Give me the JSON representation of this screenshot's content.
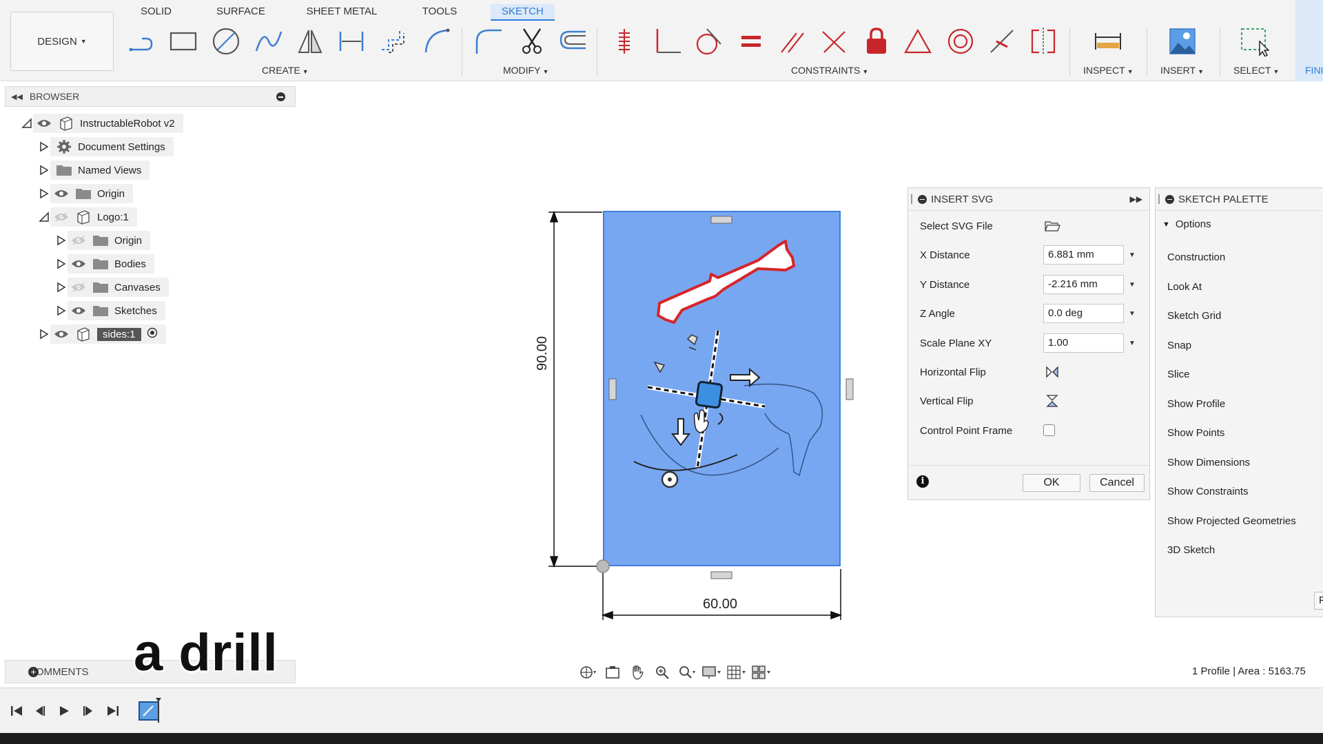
{
  "toolbar": {
    "workspace_label": "DESIGN",
    "tabs": [
      "SOLID",
      "SURFACE",
      "SHEET METAL",
      "TOOLS",
      "SKETCH"
    ],
    "active_tab": "SKETCH",
    "groups": {
      "create": "CREATE",
      "modify": "MODIFY",
      "constraints": "CONSTRAINTS",
      "inspect": "INSPECT",
      "insert": "INSERT",
      "select": "SELECT",
      "finish": "FINI"
    },
    "accent_color": "#2c7bd4",
    "constraint_color": "#c8252a"
  },
  "browser": {
    "title": "BROWSER",
    "items": [
      {
        "label": "InstructableRobot v2",
        "icon": "component-icon"
      },
      {
        "label": "Document Settings",
        "icon": "gear-icon"
      },
      {
        "label": "Named Views",
        "icon": "folder-icon"
      },
      {
        "label": "Origin",
        "icon": "folder-icon"
      },
      {
        "label": "Logo:1",
        "icon": "component-icon"
      },
      {
        "label": "Origin",
        "icon": "folder-icon"
      },
      {
        "label": "Bodies",
        "icon": "folder-icon"
      },
      {
        "label": "Canvases",
        "icon": "folder-icon"
      },
      {
        "label": "Sketches",
        "icon": "folder-icon"
      },
      {
        "label": "sides:1",
        "icon": "component-icon"
      }
    ]
  },
  "canvas": {
    "height_dim": "90.00",
    "width_dim": "60.00",
    "sketch_fill": "#78a7f2"
  },
  "insert_svg": {
    "title": "INSERT SVG",
    "fields": {
      "select_file": "Select SVG File",
      "x_distance_label": "X Distance",
      "x_distance_value": "6.881 mm",
      "y_distance_label": "Y Distance",
      "y_distance_value": "-2.216 mm",
      "z_angle_label": "Z Angle",
      "z_angle_value": "0.0 deg",
      "scale_label": "Scale Plane XY",
      "scale_value": "1.00",
      "hflip_label": "Horizontal Flip",
      "vflip_label": "Vertical Flip",
      "control_frame_label": "Control Point Frame"
    },
    "ok_label": "OK",
    "cancel_label": "Cancel"
  },
  "sketch_palette": {
    "title": "SKETCH PALETTE",
    "options_label": "Options",
    "items": [
      "Construction",
      "Look At",
      "Sketch Grid",
      "Snap",
      "Slice",
      "Show Profile",
      "Show Points",
      "Show Dimensions",
      "Show Constraints",
      "Show Projected Geometries",
      "3D Sketch"
    ],
    "finish_label": "Fi"
  },
  "comments": {
    "label": "COMMENTS"
  },
  "caption": "a drill",
  "status": "1 Profile | Area : 5163.75"
}
